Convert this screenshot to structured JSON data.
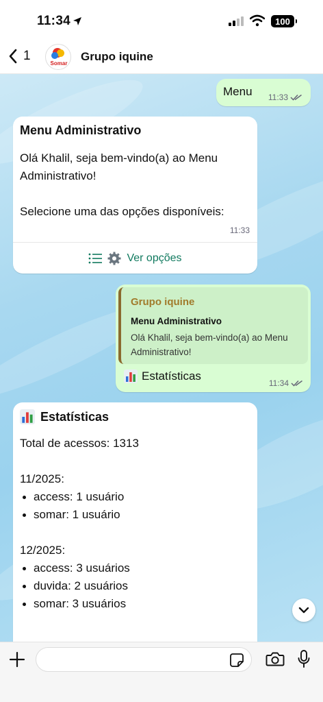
{
  "status_bar": {
    "time": "11:34",
    "battery": "100"
  },
  "header": {
    "back_count": "1",
    "avatar_label": "Somar",
    "title": "Grupo iquine"
  },
  "messages": {
    "m1": {
      "text": "Menu",
      "time": "11:33"
    },
    "m2": {
      "title": "Menu Administrativo",
      "greeting": "Olá Khalil, seja bem-vindo(a) ao Menu Administrativo!",
      "prompt": "Selecione uma das opções disponíveis:",
      "time": "11:33",
      "button_label": "Ver opções"
    },
    "m3": {
      "quote_author": "Grupo iquine",
      "quote_title": "Menu Administrativo",
      "quote_text": "Olá Khalil, seja bem-vindo(a) ao Menu Administrativo!",
      "text": "Estatísticas",
      "time": "11:34"
    },
    "m4": {
      "title": "Estatísticas",
      "total": "Total de acessos: 1313",
      "months": [
        {
          "label": "11/2025:",
          "items": [
            "access: 1 usuário",
            "somar: 1 usuário"
          ]
        },
        {
          "label": "12/2025:",
          "items": [
            "access: 3 usuários",
            "duvida: 2 usuários",
            "somar: 3 usuários"
          ]
        }
      ]
    }
  },
  "input": {
    "placeholder": "",
    "value": ""
  },
  "icons": {
    "back": "chevron-left-icon",
    "location": "location-arrow-icon",
    "signal": "signal-icon",
    "wifi": "wifi-icon",
    "read": "double-check-icon",
    "list": "list-icon",
    "gear": "gear-icon",
    "chart": "bar-chart-icon",
    "scroll": "chevron-down-icon",
    "plus": "plus-icon",
    "sticker": "sticker-icon",
    "camera": "camera-icon",
    "mic": "microphone-icon"
  },
  "colors": {
    "outgoing_bubble": "#d9fdd3",
    "incoming_bubble": "#ffffff",
    "accent": "#117a5f",
    "quote_author": "#a17b2c"
  }
}
